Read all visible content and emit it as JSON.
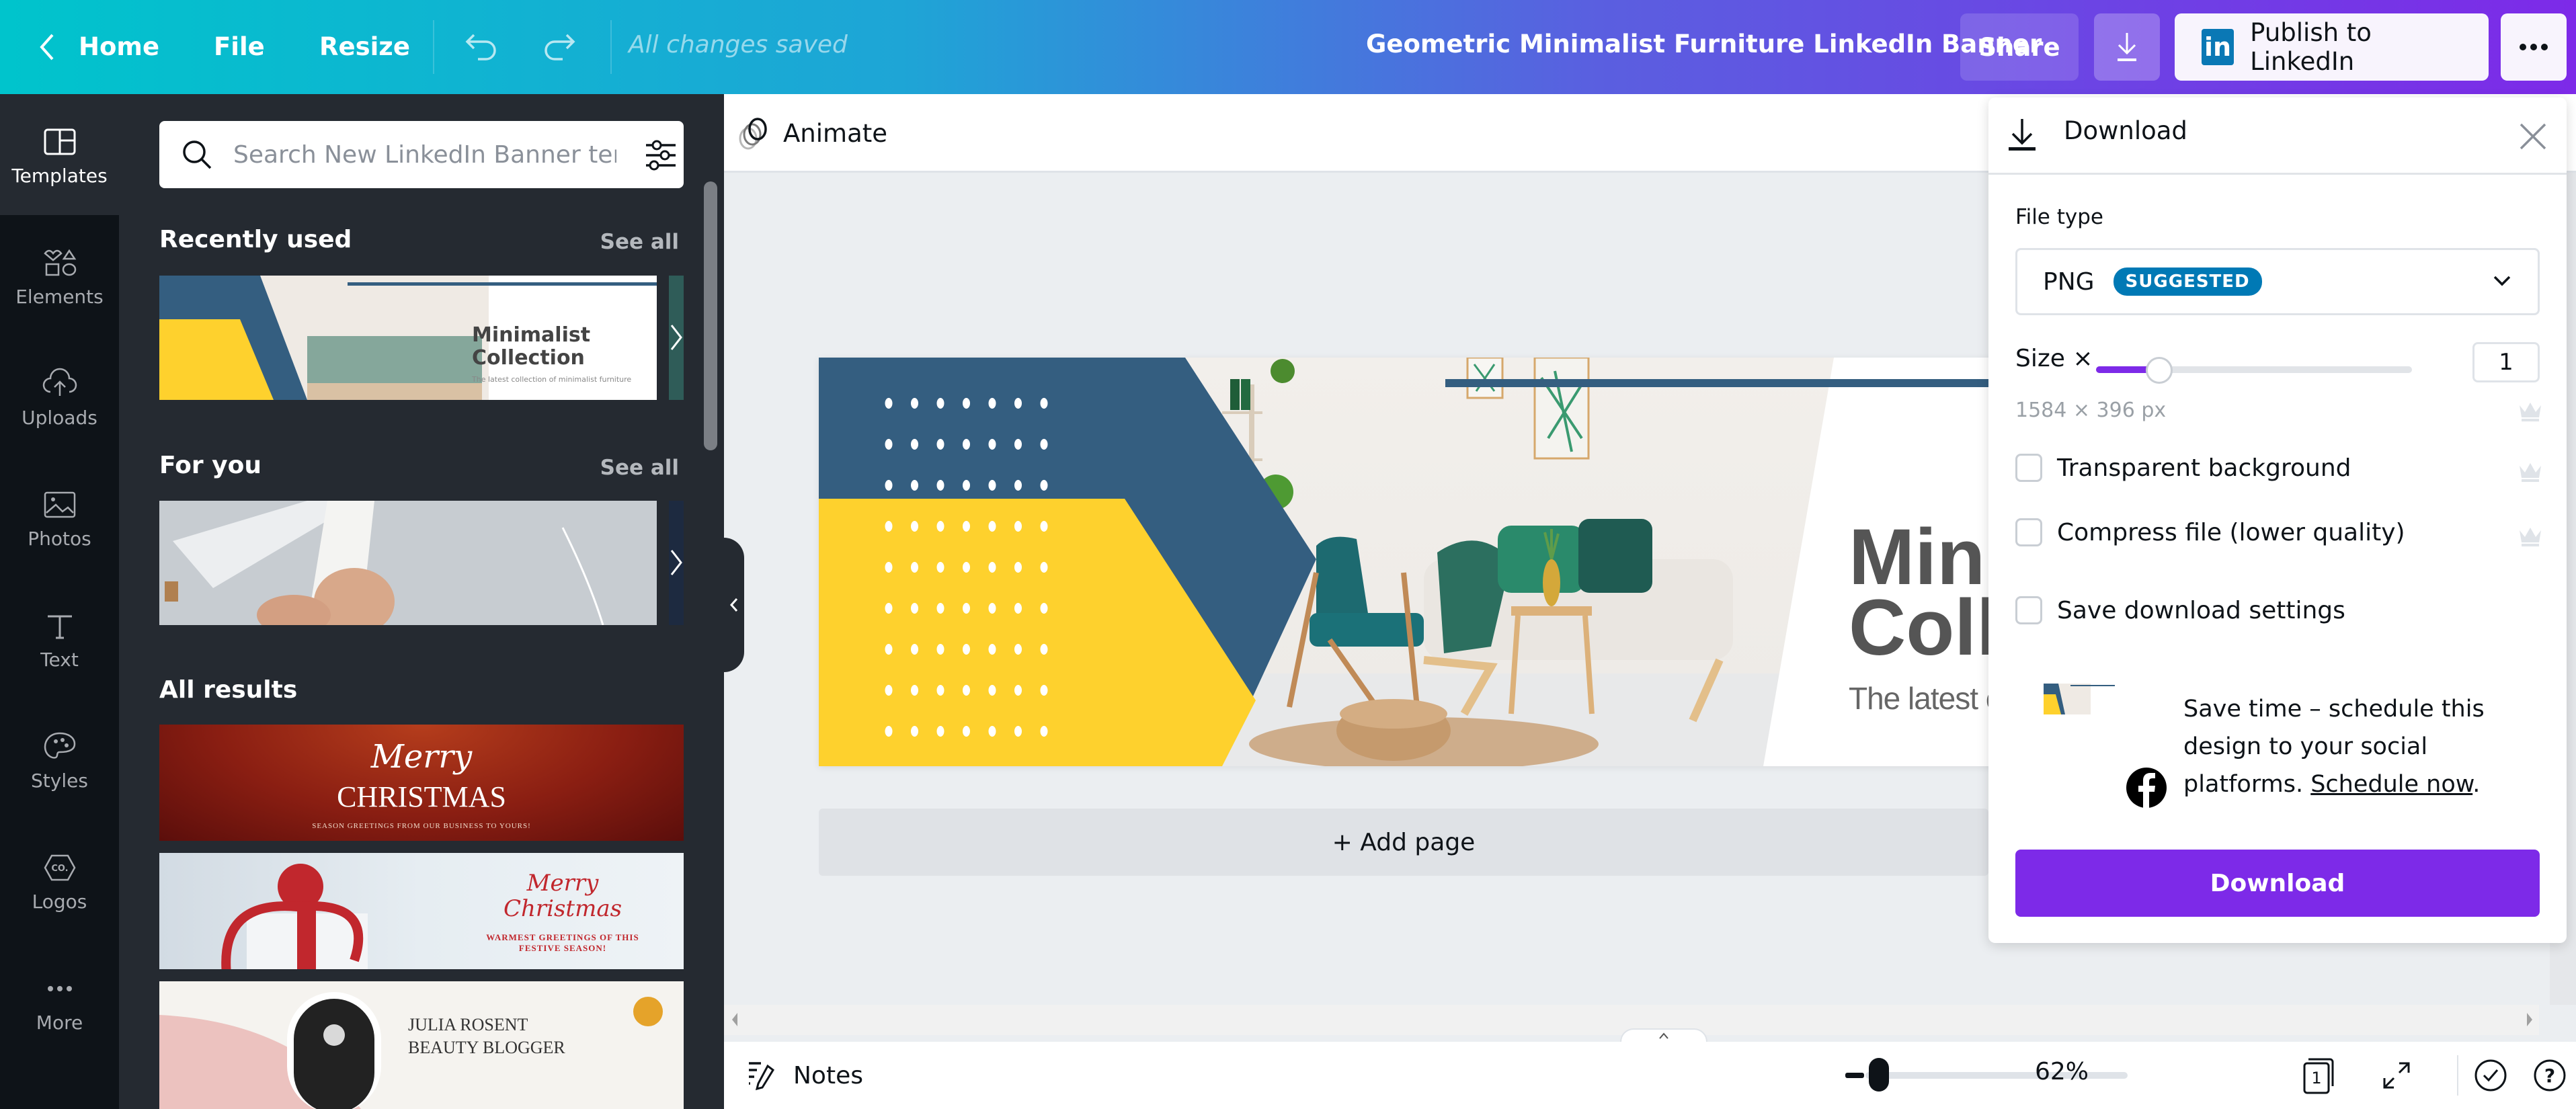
{
  "topbar": {
    "home_label": "Home",
    "file_label": "File",
    "resize_label": "Resize",
    "save_status": "All changes saved",
    "doc_title": "Geometric Minimalist Furniture LinkedIn Banner",
    "share_label": "Share",
    "publish_label": "Publish to LinkedIn",
    "linkedin_logo_text": "in"
  },
  "rail": {
    "items": [
      {
        "label": "Templates",
        "icon": "templates-icon",
        "active": true
      },
      {
        "label": "Elements",
        "icon": "elements-icon"
      },
      {
        "label": "Uploads",
        "icon": "upload-cloud-icon"
      },
      {
        "label": "Photos",
        "icon": "photos-icon"
      },
      {
        "label": "Text",
        "icon": "text-icon"
      },
      {
        "label": "Styles",
        "icon": "palette-icon"
      },
      {
        "label": "Logos",
        "icon": "logo-icon"
      },
      {
        "label": "More",
        "icon": "more-dots-icon"
      }
    ]
  },
  "panel": {
    "search_placeholder": "Search New LinkedIn Banner temp",
    "sections": {
      "recent": {
        "title": "Recently used",
        "see_all": "See all"
      },
      "for_you": {
        "title": "For you",
        "see_all": "See all"
      },
      "all_results": {
        "title": "All results"
      }
    },
    "recent_thumb": {
      "title_line1": "Minimalist",
      "title_line2": "Collection",
      "tagline": "The latest collection of minimalist furniture"
    },
    "results": [
      {
        "script": "Merry",
        "title": "CHRISTMAS",
        "subtitle": "SEASON GREETINGS FROM OUR BUSINESS TO YOURS!"
      },
      {
        "script_line1": "Merry",
        "script_line2": "Christmas",
        "subtitle_line1": "WARMEST GREETINGS OF THIS",
        "subtitle_line2": "FESTIVE SEASON!"
      },
      {
        "line1": "JULIA ROSENT",
        "line2": "BEAUTY BLOGGER"
      }
    ]
  },
  "canvas": {
    "animate_label": "Animate",
    "design": {
      "title_line1": "Minimalist",
      "title_line2": "Collection",
      "tagline": "The latest collection of minimalist furniture"
    },
    "add_page_label": "+ Add page",
    "colors": {
      "navy": "#345e80",
      "yellow": "#fed12d",
      "title_gray": "#555555"
    }
  },
  "bottombar": {
    "notes_label": "Notes",
    "zoom_value": "62%",
    "zoom_fraction": 0.05,
    "page_count": "1"
  },
  "download_panel": {
    "title": "Download",
    "file_type_label": "File type",
    "file_type_value": "PNG",
    "suggested_badge": "SUGGESTED",
    "size_label": "Size ×",
    "size_value": "1",
    "size_fraction": 0.2,
    "dimensions": "1584 × 396 px",
    "options": [
      {
        "label": "Transparent background",
        "checked": false,
        "premium": true
      },
      {
        "label": "Compress file (lower quality)",
        "checked": false,
        "premium": true
      },
      {
        "label": "Save download settings",
        "checked": false,
        "premium": false
      }
    ],
    "promo_text": "Save time – schedule this design to your social platforms.",
    "promo_link": "Schedule now",
    "promo_suffix": ".",
    "download_button": "Download"
  },
  "colors": {
    "accent_purple": "#7d2ae8",
    "topbar_start": "#00c4cc",
    "topbar_end": "#7d2ae8",
    "rail_bg": "#0e1318",
    "panel_bg": "#252a31",
    "linkedin_blue": "#0a78b5",
    "suggested_blue": "#0079b5"
  }
}
